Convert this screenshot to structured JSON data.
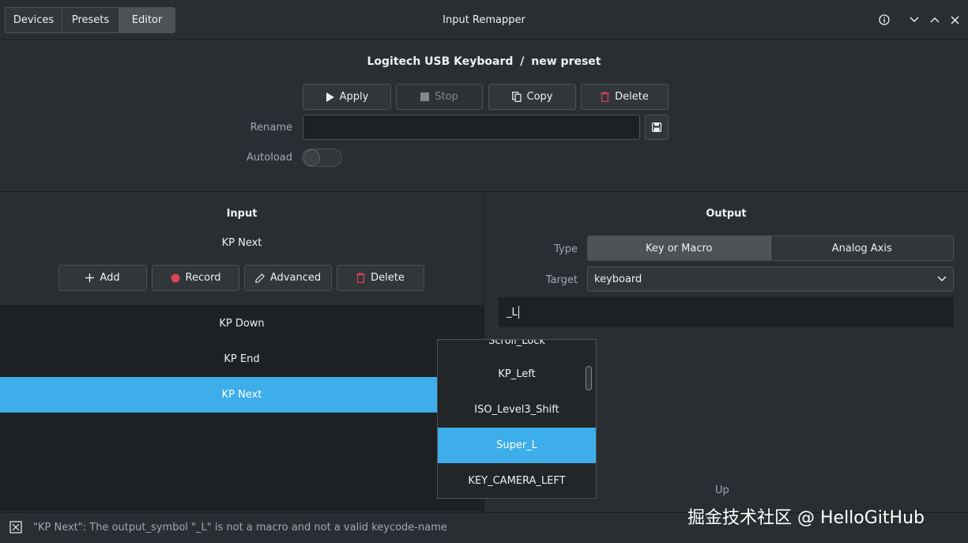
{
  "header": {
    "tabs": [
      "Devices",
      "Presets",
      "Editor"
    ],
    "active_tab": "Editor",
    "title": "Input Remapper"
  },
  "preset": {
    "heading_device": "Logitech USB Keyboard",
    "heading_sep": "/",
    "heading_preset": "new preset",
    "apply_label": "Apply",
    "stop_label": "Stop",
    "copy_label": "Copy",
    "delete_label": "Delete",
    "rename_label": "Rename",
    "rename_value": "",
    "autoload_label": "Autoload",
    "autoload_on": false
  },
  "input": {
    "title": "Input",
    "current": "KP Next",
    "add_label": "Add",
    "record_label": "Record",
    "advanced_label": "Advanced",
    "delete_label": "Delete",
    "rows": [
      "KP Down",
      "KP End",
      "KP Next"
    ],
    "selected_row": "KP Next"
  },
  "output": {
    "title": "Output",
    "type_label": "Type",
    "type_options": [
      "Key or Macro",
      "Analog Axis"
    ],
    "type_selected": "Key or Macro",
    "target_label": "Target",
    "target_value": "keyboard",
    "symbol_value": "_L",
    "footer_hint": "Up"
  },
  "autocomplete": {
    "partial_top": "Scroll_Lock",
    "items": [
      "KP_Left",
      "ISO_Level3_Shift",
      "Super_L",
      "KEY_CAMERA_LEFT"
    ],
    "selected": "Super_L"
  },
  "status": {
    "message": "\"KP Next\": The output_symbol \"_L\" is not a macro and not a valid keycode-name"
  },
  "watermark": "掘金技术社区 @ HelloGitHub",
  "colors": {
    "accent": "#3daee9",
    "bg": "#2a2e32",
    "list_bg": "#1e2124",
    "record_dot": "#da4453",
    "delete_icon": "#da4453"
  }
}
